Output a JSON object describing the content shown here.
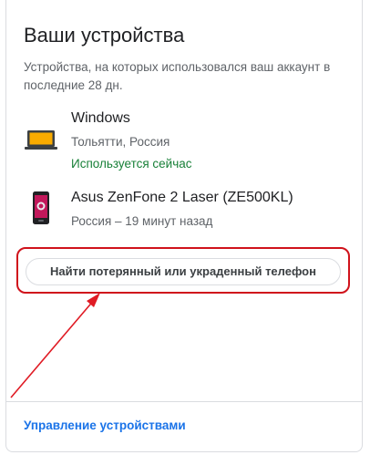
{
  "panel": {
    "title": "Ваши устройства",
    "description": "Устройства, на которых использовался ваш аккаунт в последние 28 дн."
  },
  "devices": [
    {
      "name": "Windows",
      "location": "Тольятти, Россия",
      "status": "Используется сейчас",
      "icon": "laptop-icon"
    },
    {
      "name": "Asus ZenFone 2 Laser (ZE500KL)",
      "location": "Россия – 19 минут назад",
      "icon": "phone-icon"
    }
  ],
  "actions": {
    "find_phone_label": "Найти потерянный или украденный телефон",
    "manage_devices_label": "Управление устройствами"
  },
  "colors": {
    "status_active": "#188038",
    "link": "#1a73e8",
    "highlight": "#d0121b"
  }
}
